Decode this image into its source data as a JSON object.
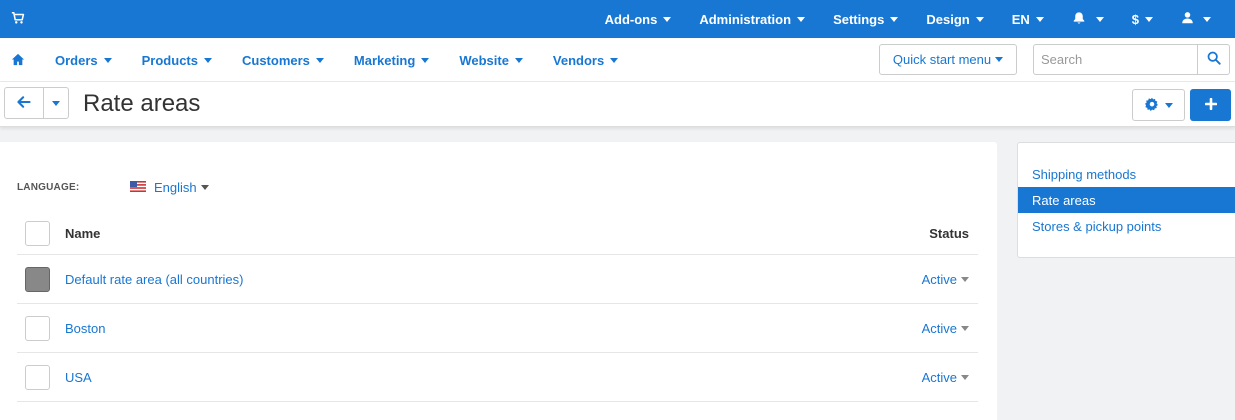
{
  "colors": {
    "primary": "#1877d2",
    "background": "#f0f2f4"
  },
  "topbar": {
    "cart_icon": "cart-icon",
    "items": [
      {
        "label": "Add-ons"
      },
      {
        "label": "Administration"
      },
      {
        "label": "Settings"
      },
      {
        "label": "Design"
      },
      {
        "label": "EN"
      },
      {
        "icon": "bell-icon"
      },
      {
        "label": "$"
      },
      {
        "icon": "user-icon"
      }
    ]
  },
  "navbar": {
    "home_icon": "home-icon",
    "items": [
      {
        "label": "Orders"
      },
      {
        "label": "Products"
      },
      {
        "label": "Customers"
      },
      {
        "label": "Marketing"
      },
      {
        "label": "Website"
      },
      {
        "label": "Vendors"
      }
    ],
    "quick_start_label": "Quick start menu",
    "search_placeholder": "Search",
    "search_icon": "search-icon"
  },
  "page": {
    "title": "Rate areas",
    "back_icon": "arrow-left-icon",
    "settings_icon": "gear-icon",
    "add_icon": "plus-icon"
  },
  "content": {
    "language_label": "LANGUAGE:",
    "language_value": "English",
    "language_flag_icon": "us-flag-icon",
    "columns": {
      "name": "Name",
      "status": "Status"
    },
    "rows": [
      {
        "name": "Default rate area (all countries)",
        "status": "Active",
        "checkbox_disabled": true
      },
      {
        "name": "Boston",
        "status": "Active",
        "checkbox_disabled": false
      },
      {
        "name": "USA",
        "status": "Active",
        "checkbox_disabled": false
      }
    ]
  },
  "sidebar": {
    "items": [
      {
        "label": "Shipping methods",
        "active": false
      },
      {
        "label": "Rate areas",
        "active": true
      },
      {
        "label": "Stores & pickup points",
        "active": false
      }
    ]
  }
}
